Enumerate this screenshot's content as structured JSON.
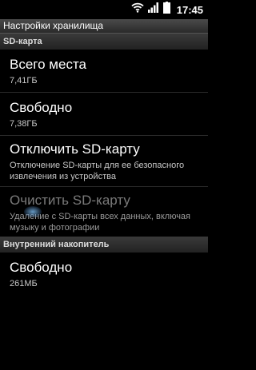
{
  "status_bar": {
    "time": "17:45",
    "icons": [
      "wifi-icon",
      "signal-icon",
      "battery-icon"
    ]
  },
  "title": "Настройки хранилища",
  "sd_section": {
    "header": "SD-карта",
    "total": {
      "label": "Всего места",
      "value": "7,41ГБ"
    },
    "free": {
      "label": "Свободно",
      "value": "7,38ГБ"
    },
    "unmount": {
      "label": "Отключить SD-карту",
      "description": "Отключение SD-карты для ее безопасного извлечения из устройства"
    },
    "erase": {
      "label": "Очистить SD-карту",
      "description": "Удаление с SD-карты всех данных, включая музыку и фотографии"
    }
  },
  "internal_section": {
    "header": "Внутренний накопитель",
    "free": {
      "label": "Свободно",
      "value": "261МБ"
    }
  },
  "colors": {
    "background": "#000000",
    "header_gradient_top": "#3a3a3a",
    "disabled_text": "#7a7a7a"
  }
}
